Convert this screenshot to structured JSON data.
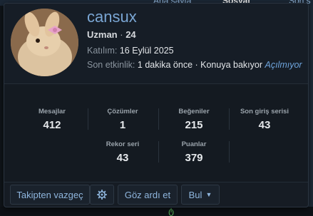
{
  "background": {
    "top_items": [
      "Ana sayfa",
      "Sosyal",
      "Son s"
    ]
  },
  "profile": {
    "name": "cansux",
    "role": "Uzman",
    "count": "24",
    "joined_label": "Katılım:",
    "joined_value": "16 Eylül 2025",
    "last_activity_label": "Son etkinlik:",
    "last_activity_value": "1 dakika önce · Konuya bakıyor",
    "last_activity_link": "Açılmıyor"
  },
  "stats": [
    {
      "label": "Mesajlar",
      "value": "412"
    },
    {
      "label": "Çözümler",
      "value": "1"
    },
    {
      "label": "Beğeniler",
      "value": "215"
    },
    {
      "label": "Son giriş serisi",
      "value": "43"
    },
    {
      "label": "Rekor seri",
      "value": "43"
    },
    {
      "label": "Puanlar",
      "value": "379"
    }
  ],
  "actions": {
    "unfollow": "Takipten vazgeç",
    "ignore": "Göz ardı et",
    "find": "Bul"
  },
  "colors": {
    "name": "#7aa6d4",
    "link": "#6ea4dc",
    "card_bg": "#161c24"
  }
}
